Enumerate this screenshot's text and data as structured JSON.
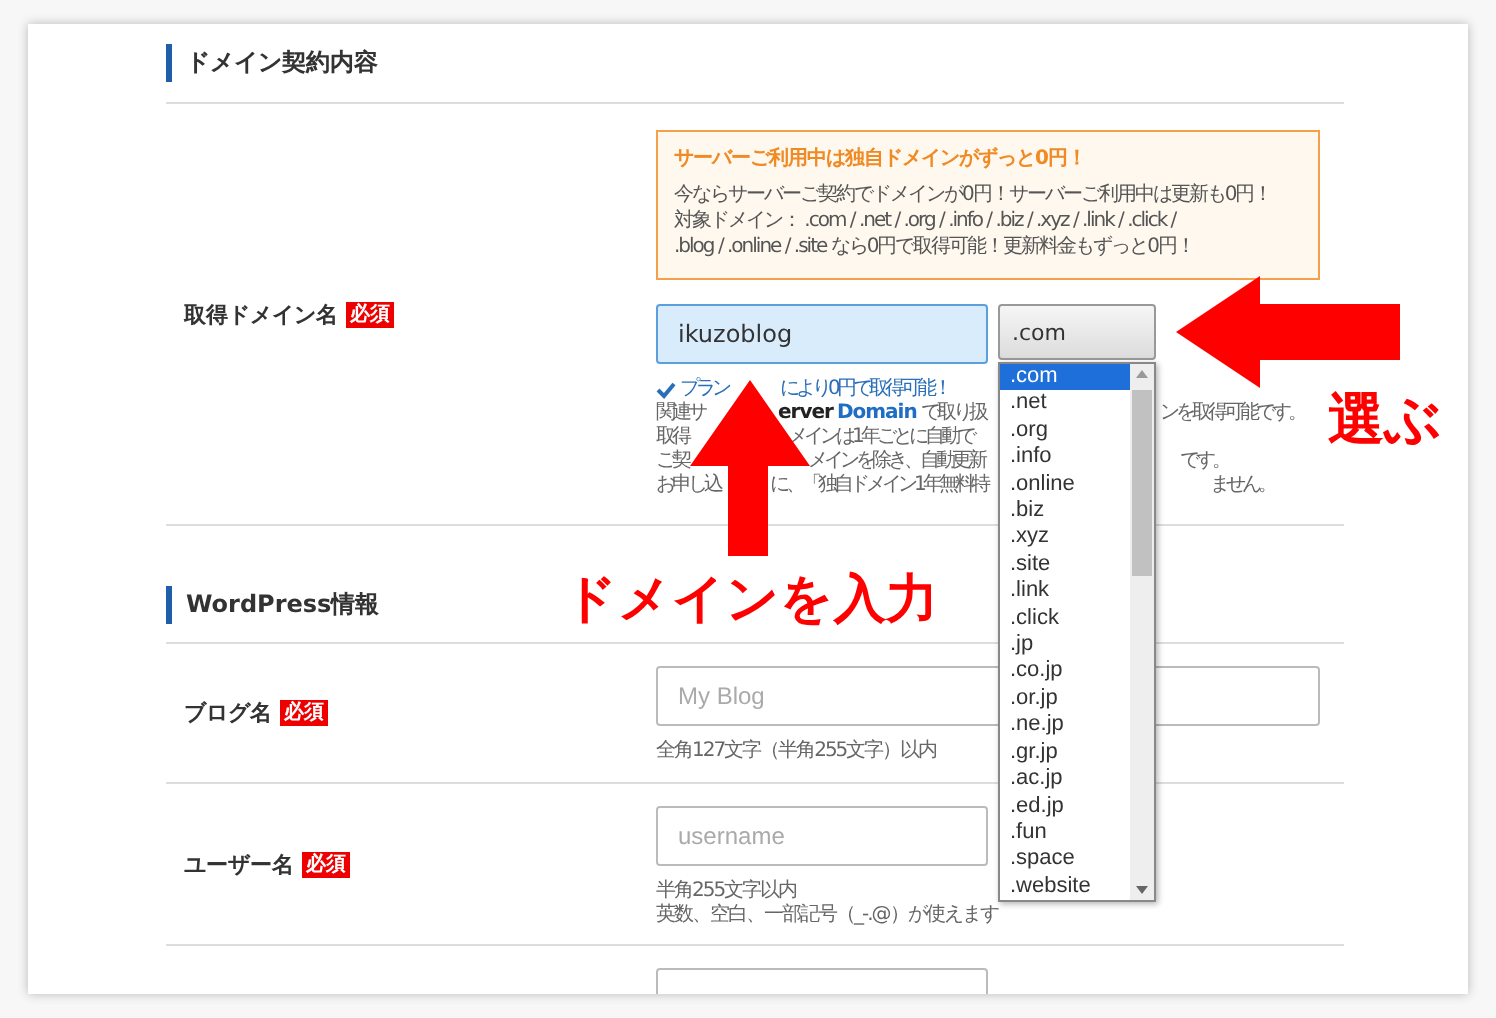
{
  "sections": [
    {
      "title": "ドメイン契約内容",
      "rows": [
        {
          "kind": "domain",
          "label": "取得ドメイン名",
          "required": "必須",
          "promo": {
            "title": "サーバーご利用中は独自ドメインがずっと0円！",
            "lines": [
              "今ならサーバーご契約でドメインが0円！サーバーご利用中は更新も0円！",
              "対象ドメイン： .com / .net / .org / .info / .biz / .xyz / .link / .click /",
              ".blog / .online / .site なら0円で取得可能！更新料金もずっと0円！"
            ]
          },
          "field": {
            "value": "ikuzoblog"
          },
          "select": {
            "value": ".com",
            "options": [
              {
                "label": ".com",
                "selected": true
              },
              {
                "label": ".net",
                "selected": false
              },
              {
                "label": ".org",
                "selected": false
              },
              {
                "label": ".info",
                "selected": false
              },
              {
                "label": ".online",
                "selected": false
              },
              {
                "label": ".biz",
                "selected": false
              },
              {
                "label": ".xyz",
                "selected": false
              },
              {
                "label": ".site",
                "selected": false
              },
              {
                "label": ".link",
                "selected": false
              },
              {
                "label": ".click",
                "selected": false
              },
              {
                "label": ".jp",
                "selected": false
              },
              {
                "label": ".co.jp",
                "selected": false
              },
              {
                "label": ".or.jp",
                "selected": false
              },
              {
                "label": ".ne.jp",
                "selected": false
              },
              {
                "label": ".gr.jp",
                "selected": false
              },
              {
                "label": ".ac.jp",
                "selected": false
              },
              {
                "label": ".ed.jp",
                "selected": false
              },
              {
                "label": ".fun",
                "selected": false
              },
              {
                "label": ".space",
                "selected": false
              },
              {
                "label": ".website",
                "selected": false
              }
            ]
          },
          "notes": [
            {
              "kind": "check",
              "parts": [
                {
                  "text": "プラン",
                  "kind": "plain"
                },
                {
                  "text": "により0円で取得可能！",
                  "kind": "plain"
                }
              ]
            },
            {
              "kind": "plain",
              "parts": [
                {
                  "text": "関連サ",
                  "kind": "plain"
                },
                {
                  "text": "erver",
                  "kind": "brand"
                },
                {
                  "text": "Domain",
                  "kind": "accent"
                },
                {
                  "text": "で取り扱",
                  "kind": "plain"
                },
                {
                  "text": "ンを取得可能です。",
                  "kind": "plain"
                }
              ]
            },
            {
              "kind": "plain",
              "parts": [
                {
                  "text": "取得",
                  "kind": "plain"
                },
                {
                  "text": "メインは1年ごとに自動で",
                  "kind": "plain"
                }
              ]
            },
            {
              "kind": "plain",
              "parts": [
                {
                  "text": "ご契",
                  "kind": "plain"
                },
                {
                  "text": "メインを除き、自動更新",
                  "kind": "plain"
                },
                {
                  "text": "です。",
                  "kind": "plain"
                }
              ]
            },
            {
              "kind": "plain",
              "parts": [
                {
                  "text": "お申し込",
                  "kind": "plain"
                },
                {
                  "text": "に、「独自ドメイン1年無料特",
                  "kind": "plain"
                },
                {
                  "text": "ません。",
                  "kind": "plain"
                }
              ]
            }
          ]
        }
      ]
    },
    {
      "title": "WordPress情報",
      "rows": [
        {
          "kind": "wide",
          "label": "ブログ名",
          "required": "必須",
          "field": {
            "placeholder": "My Blog"
          },
          "hints": [
            "全角127文字（半角255文字）以内"
          ]
        },
        {
          "kind": "narrow",
          "label": "ユーザー名",
          "required": "必須",
          "field": {
            "placeholder": "username"
          },
          "hints": [
            "半角255文字以内",
            "英数、空白、一部記号（_-.@）が使えます"
          ]
        },
        {
          "kind": "partial"
        }
      ]
    }
  ],
  "annotations": [
    {
      "kind": "left",
      "text": "選ぶ"
    },
    {
      "kind": "up",
      "text": "ドメインを入力"
    }
  ]
}
